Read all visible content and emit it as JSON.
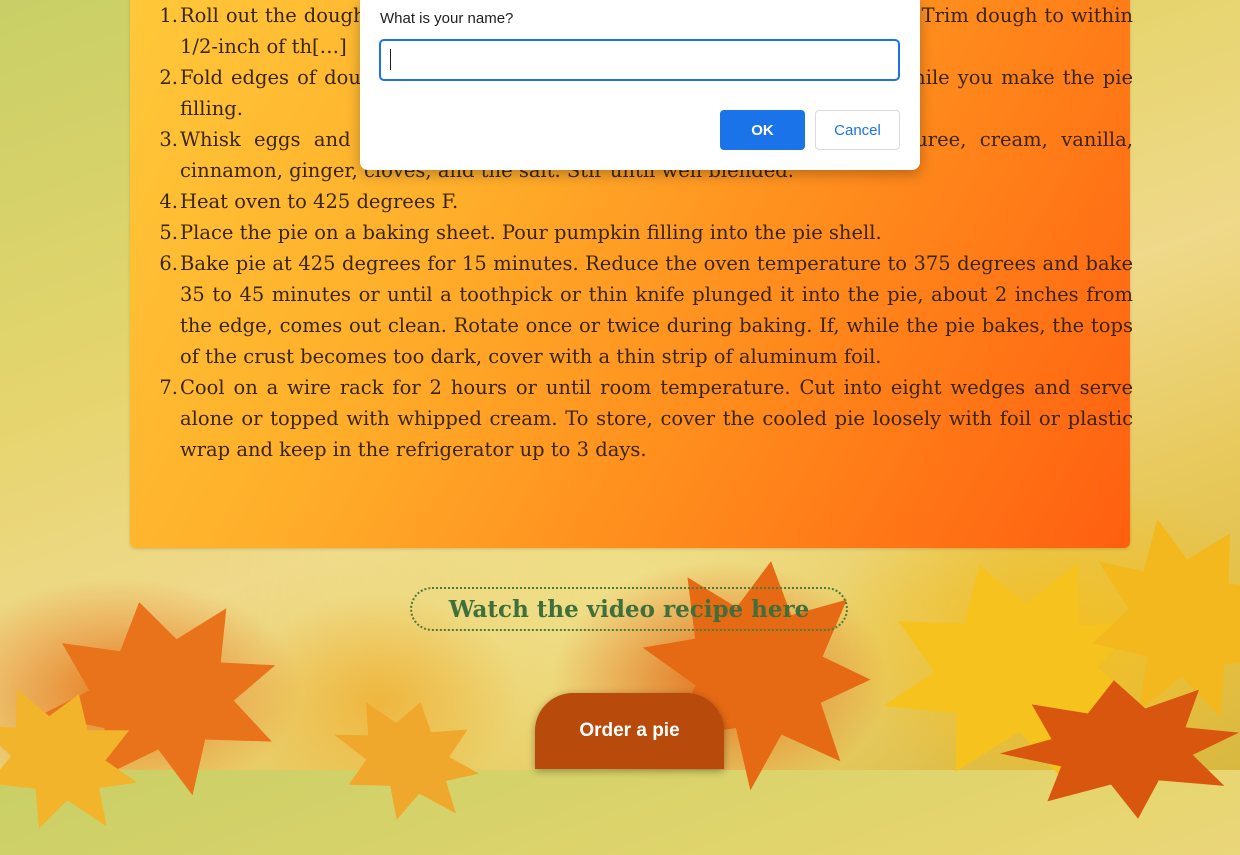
{
  "recipe_steps": [
    {
      "num": "1.",
      "text": "Roll out the dough s[…]dough down into the dish so that it lines […]ugh). Trim dough to within 1/2-inch of th[…]"
    },
    {
      "num": "2.",
      "text": "Fold edges of dough […]sts on the lip of the dish. Crimp edges. ([…]e while you make the pie filling."
    },
    {
      "num": "3.",
      "text": "Whisk eggs and both sugars together until smooth. Add pumpkin puree, cream, vanilla, cinnamon, ginger, cloves, and the salt. Stir until well blended."
    },
    {
      "num": "4.",
      "text": "Heat oven to 425 degrees F."
    },
    {
      "num": "5.",
      "text": "Place the pie on a baking sheet. Pour pumpkin filling into the pie shell."
    },
    {
      "num": "6.",
      "text": "Bake pie at 425 degrees for 15 minutes. Reduce the oven temperature to 375 degrees and bake 35 to 45 minutes or until a toothpick or thin knife plunged it into the pie, about 2 inches from the edge, comes out clean. Rotate once or twice during baking. If, while the pie bakes, the tops of the crust becomes too dark, cover with a thin strip of aluminum foil."
    },
    {
      "num": "7.",
      "text": "Cool on a wire rack for 2 hours or until room temperature. Cut into eight wedges and serve alone or topped with whipped cream. To store, cover the cooled pie loosely with foil or plastic wrap and keep in the refrigerator up to 3 days."
    }
  ],
  "video_link": {
    "label": "Watch the video recipe here"
  },
  "order_button": {
    "label": "Order a pie"
  },
  "prompt_dialog": {
    "message": "What is your name?",
    "input_value": "",
    "ok_label": "OK",
    "cancel_label": "Cancel"
  },
  "colors": {
    "card_start": "#ffc93a",
    "card_end": "#ff5f10",
    "link_green": "#3f6f3a",
    "order_button": "#b84a0c",
    "dialog_accent": "#1a73e8"
  }
}
